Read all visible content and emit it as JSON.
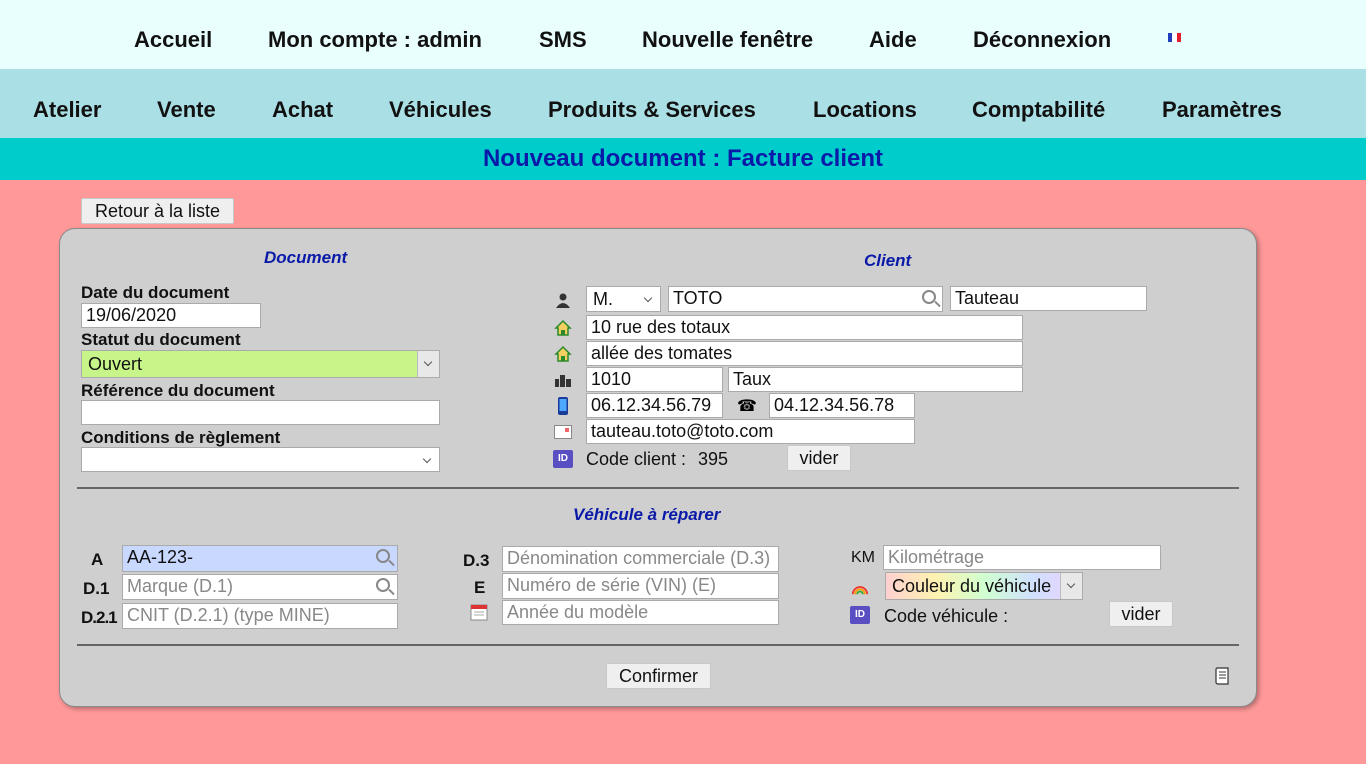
{
  "top_menu": {
    "home": "Accueil",
    "account": "Mon compte : admin",
    "sms": "SMS",
    "new_window": "Nouvelle fenêtre",
    "help": "Aide",
    "logout": "Déconnexion"
  },
  "main_menu": {
    "workshop": "Atelier",
    "sale": "Vente",
    "purchase": "Achat",
    "vehicles": "Véhicules",
    "products": "Produits & Services",
    "rentals": "Locations",
    "accounting": "Comptabilité",
    "settings": "Paramètres"
  },
  "page_title": "Nouveau document : Facture client",
  "back_button": "Retour à la liste",
  "document": {
    "title": "Document",
    "date_label": "Date du document",
    "date_value": "19/06/2020",
    "status_label": "Statut du document",
    "status_value": "Ouvert",
    "reference_label": "Référence du document",
    "reference_value": "",
    "terms_label": "Conditions de règlement",
    "terms_value": ""
  },
  "client": {
    "title": "Client",
    "civility": "M.",
    "lastname": "TOTO",
    "firstname": "Tauteau",
    "address1": "10 rue des totaux",
    "address2": "allée des tomates",
    "postcode": "1010",
    "city": "Taux",
    "mobile": "06.12.34.56.79",
    "phone": "04.12.34.56.78",
    "email": "tauteau.toto@toto.com",
    "code_label": "Code client :",
    "code_value": "395",
    "clear_button": "vider"
  },
  "vehicle": {
    "title": "Véhicule à réparer",
    "label_a": "A",
    "plate_value": "AA-123-",
    "label_d1": "D.1",
    "brand_placeholder": "Marque (D.1)",
    "label_d21": "D.2.1",
    "cnit_placeholder": "CNIT (D.2.1) (type MINE)",
    "label_d3": "D.3",
    "commercial_placeholder": "Dénomination commerciale (D.3)",
    "label_e": "E",
    "vin_placeholder": "Numéro de série (VIN) (E)",
    "year_placeholder": "Année du modèle",
    "label_km": "KM",
    "km_placeholder": "Kilométrage",
    "color_placeholder": "Couleur du véhicule",
    "code_label": "Code véhicule :",
    "clear_button": "vider"
  },
  "confirm_button": "Confirmer",
  "colors": {
    "page_bg": "#ff9999",
    "top_bg": "#e8fffe",
    "nav_bg": "#aadfe6",
    "title_bg": "#00cccc",
    "title_text": "#0a1aa8",
    "status_bg": "#c8f58a",
    "plate_bg": "#c8d8ff"
  }
}
